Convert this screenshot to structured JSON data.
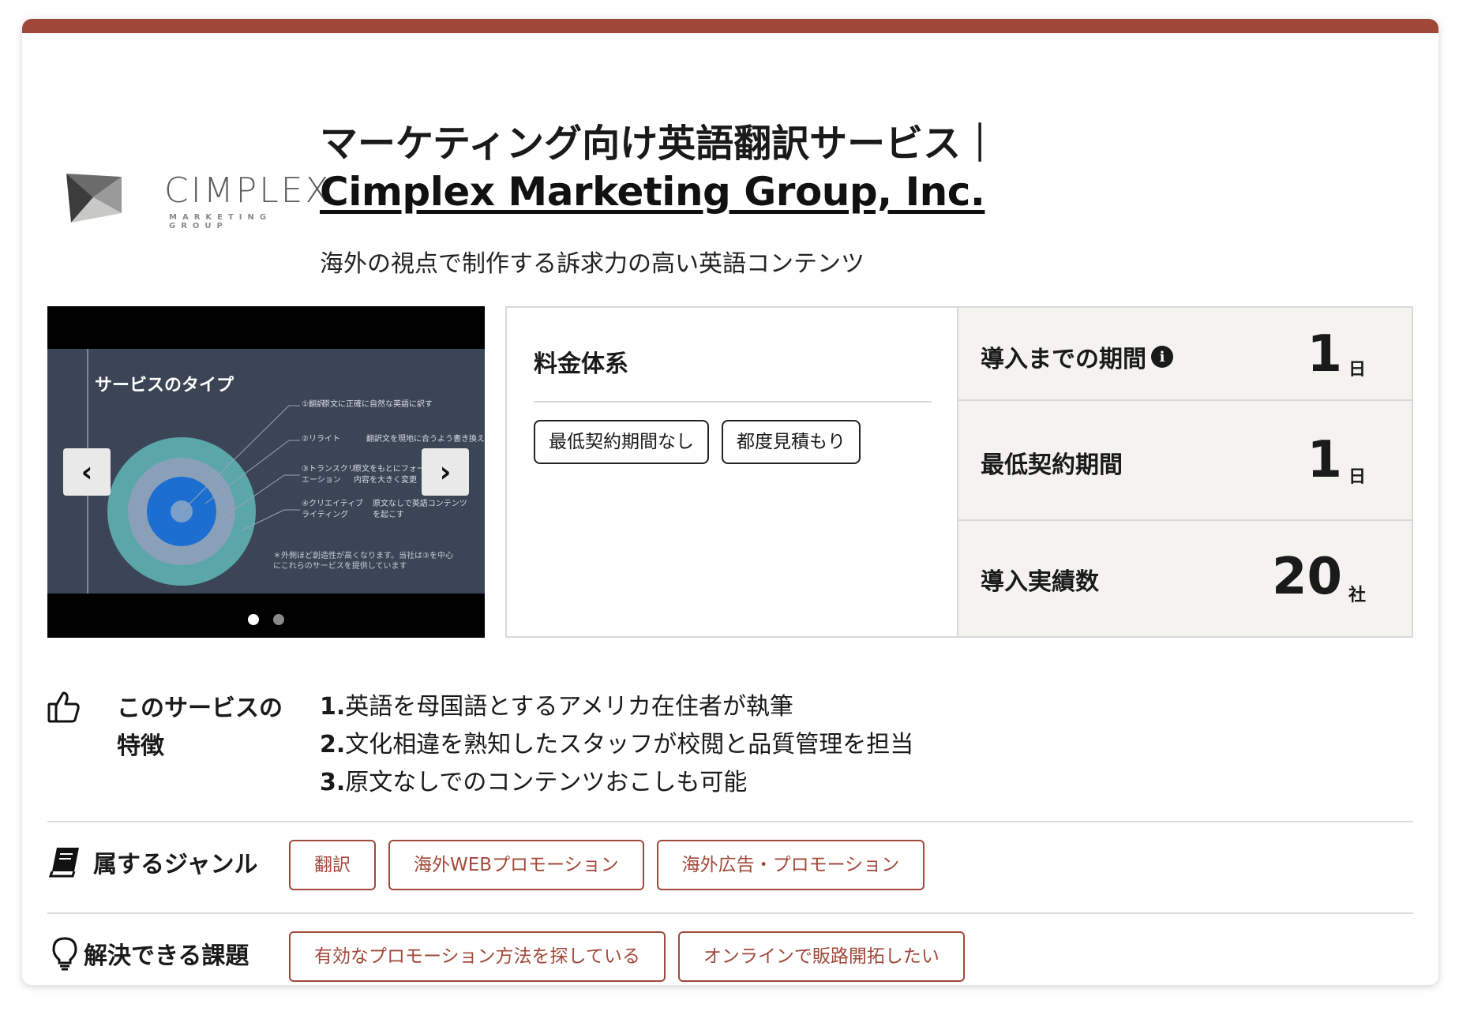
{
  "header": {
    "logo_text": "CIMPLEX",
    "logo_sub": "MARKETING GROUP",
    "title": "マーケティング向け英語翻訳サービス｜",
    "company": "Cimplex Marketing Group, Inc.",
    "subtitle": "海外の視点で制作する訴求力の高い英語コンテンツ"
  },
  "slider": {
    "slide_title": "サービスのタイプ",
    "items": [
      {
        "name": "①翻訳",
        "desc": "原文に正確に自然な英語に訳す"
      },
      {
        "name": "②リライト",
        "desc": "翻訳文を現地に合うよう書き換える"
      },
      {
        "name": "③トランスクリ\nエーション",
        "desc": "原文をもとにフォーマット\n内容を大きく変更"
      },
      {
        "name": "④クリエイティブ\nライティング",
        "desc": "原文なしで英語コンテンツ\nを起こす"
      }
    ],
    "note": "＊外側ほど創造性が高くなります。当社は③を中心\nにこれらのサービスを提供しています",
    "prev_icon": "chevron-left-icon",
    "next_icon": "chevron-right-icon",
    "dots": 2,
    "active_dot": 0
  },
  "pricing": {
    "title": "料金体系",
    "tags": [
      "最低契約期間なし",
      "都度見積もり"
    ]
  },
  "stats": [
    {
      "label": "導入までの期間",
      "value": "1",
      "unit": "日",
      "info": true
    },
    {
      "label": "最低契約期間",
      "value": "1",
      "unit": "日",
      "info": false
    },
    {
      "label": "導入実績数",
      "value": "20",
      "unit": "社",
      "info": false
    }
  ],
  "features": {
    "label_line1": "このサービスの",
    "label_line2": "特徴",
    "items": [
      {
        "num": "1.",
        "text": "英語を母国語とするアメリカ在住者が執筆"
      },
      {
        "num": "2.",
        "text": "文化相違を熟知したスタッフが校閲と品質管理を担当"
      },
      {
        "num": "3.",
        "text": "原文なしでのコンテンツおこしも可能"
      }
    ]
  },
  "genres": {
    "label": "属するジャンル",
    "tags": [
      "翻訳",
      "海外WEBプロモーション",
      "海外広告・プロモーション"
    ]
  },
  "issues": {
    "label": "解決できる課題",
    "tags": [
      "有効なプロモーション方法を探している",
      "オンラインで販路開拓したい"
    ]
  },
  "colors": {
    "accent": "#a0493a",
    "stat_bg": "#f4f3ef",
    "slide_bg": "#3b4556"
  }
}
